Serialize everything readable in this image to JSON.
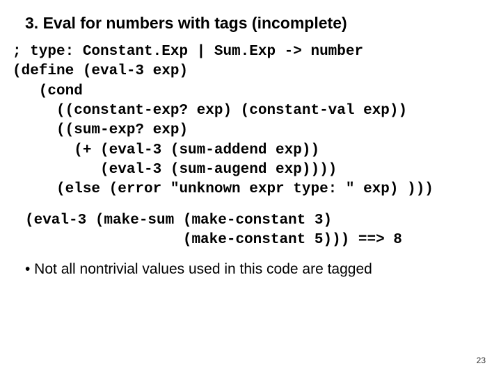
{
  "title": "3. Eval for numbers with tags (incomplete)",
  "code_block_1": "; type: Constant.Exp | Sum.Exp -> number\n(define (eval-3 exp)\n   (cond\n     ((constant-exp? exp) (constant-val exp))\n     ((sum-exp? exp)\n       (+ (eval-3 (sum-addend exp))\n          (eval-3 (sum-augend exp))))\n     (else (error \"unknown expr type: \" exp) )))",
  "code_block_2": "(eval-3 (make-sum (make-constant 3)\n                  (make-constant 5))) ==> 8",
  "bullet": "• Not all nontrivial values used in this code are tagged",
  "page_number": "23"
}
